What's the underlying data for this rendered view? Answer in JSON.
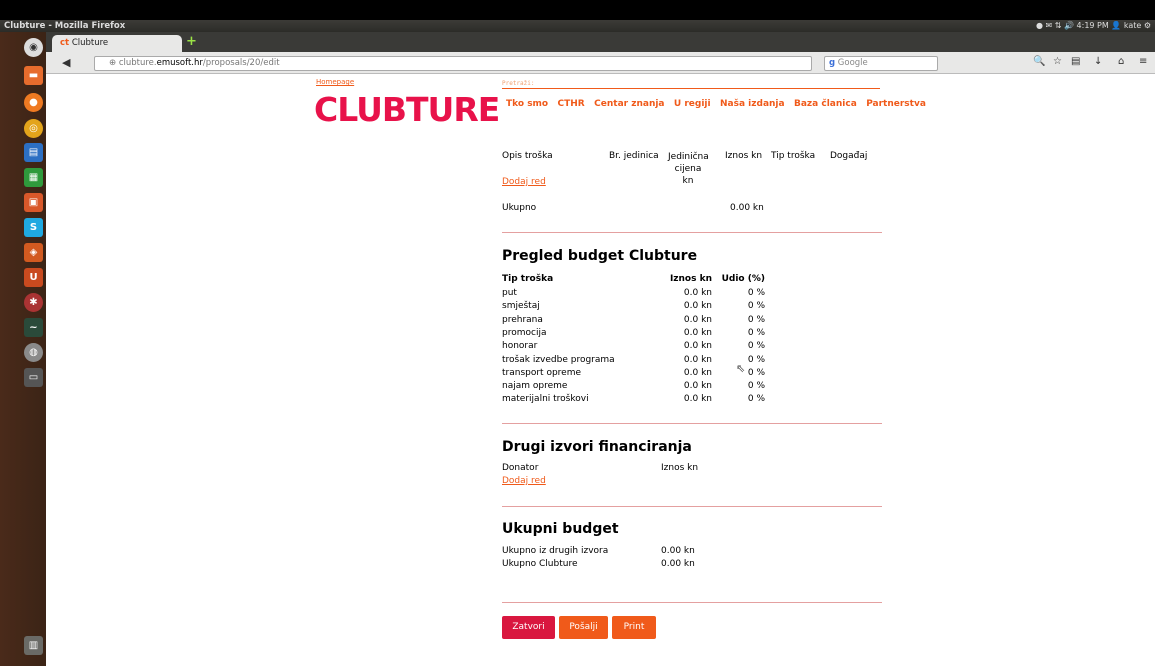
{
  "window": {
    "title": "Clubture - Mozilla Firefox"
  },
  "panel": {
    "time": "4:19 PM",
    "user": "kate"
  },
  "browser": {
    "tab_title": "Clubture",
    "url_prefix": "clubture.",
    "url_domain": "emusoft.hr",
    "url_path": "/proposals/20/edit",
    "search_placeholder": "Google"
  },
  "page": {
    "homepage_link": "Homepage",
    "search_label": "Pretraži:",
    "logo_text": "CLUBTURE",
    "nav": [
      "Tko smo",
      "CTHR",
      "Centar znanja",
      "U regiji",
      "Naša izdanja",
      "Baza članica",
      "Partnerstva"
    ],
    "expenses": {
      "headers": [
        "Opis troška",
        "Br. jedinica",
        "Jedinična cijena kn",
        "Iznos kn",
        "Tip troška",
        "Događaj"
      ],
      "add_row": "Dodaj red",
      "total_label": "Ukupno",
      "total_value": "0.00 kn"
    },
    "budget": {
      "title": "Pregled budget Clubture",
      "headers": [
        "Tip troška",
        "Iznos kn",
        "Udio (%)"
      ],
      "rows": [
        [
          "put",
          "0.0 kn",
          "0 %"
        ],
        [
          "smještaj",
          "0.0 kn",
          "0 %"
        ],
        [
          "prehrana",
          "0.0 kn",
          "0 %"
        ],
        [
          "promocija",
          "0.0 kn",
          "0 %"
        ],
        [
          "honorar",
          "0.0 kn",
          "0 %"
        ],
        [
          "trošak izvedbe programa",
          "0.0 kn",
          "0 %"
        ],
        [
          "transport opreme",
          "0.0 kn",
          "0 %"
        ],
        [
          "najam opreme",
          "0.0 kn",
          "0 %"
        ],
        [
          "materijalni troškovi",
          "0.0 kn",
          "0 %"
        ]
      ]
    },
    "other": {
      "title": "Drugi izvori financiranja",
      "headers": [
        "Donator",
        "Iznos kn"
      ],
      "add_row": "Dodaj red"
    },
    "total": {
      "title": "Ukupni budget",
      "rows": [
        [
          "Ukupno iz drugih izvora",
          "0.00 kn"
        ],
        [
          "Ukupno Clubture",
          "0.00 kn"
        ]
      ]
    },
    "buttons": {
      "close": "Zatvori",
      "send": "Pošalji",
      "print": "Print"
    },
    "colors": {
      "accent": "#f05a1a",
      "logo": "#e8124a",
      "close_btn": "#d9173f"
    }
  }
}
